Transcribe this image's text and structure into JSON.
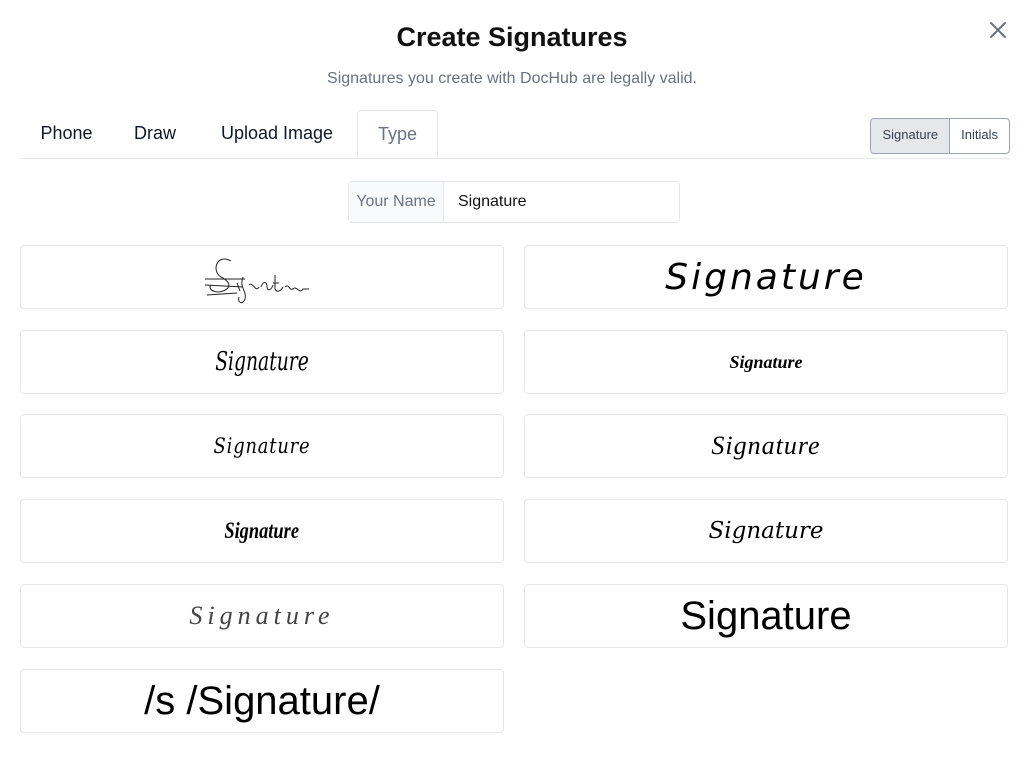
{
  "dialog": {
    "title": "Create Signatures",
    "subtitle": "Signatures you create with DocHub are legally valid."
  },
  "tabs": [
    {
      "label": "Phone"
    },
    {
      "label": "Draw"
    },
    {
      "label": "Upload Image"
    },
    {
      "label": "Type",
      "active": true
    }
  ],
  "mode_toggle": {
    "signature_label": "Signature",
    "initials_label": "Initials",
    "selected": "Signature"
  },
  "name_field": {
    "label": "Your Name",
    "value": "Signature"
  },
  "signature_options": [
    {
      "text": "Signature",
      "style": "hand-sketch-1"
    },
    {
      "text": "Signature",
      "style": "hand-print-wide"
    },
    {
      "text": "Signature",
      "style": "hand-tall-script"
    },
    {
      "text": "Signature",
      "style": "hand-bold-script"
    },
    {
      "text": "Signature",
      "style": "hand-small-script"
    },
    {
      "text": "Signature",
      "style": "hand-flourish"
    },
    {
      "text": "Signature",
      "style": "hand-brush"
    },
    {
      "text": "Signature",
      "style": "hand-thin-script"
    },
    {
      "text": "Signature",
      "style": "hand-wide-thin"
    },
    {
      "text": "Signature",
      "style": "plain-sans"
    },
    {
      "text": "/s /Signature/",
      "style": "slash-typed"
    }
  ],
  "icons": {
    "close": "close-icon"
  }
}
